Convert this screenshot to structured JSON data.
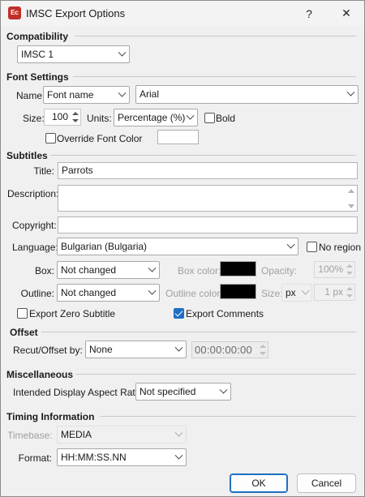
{
  "window": {
    "title": "IMSC Export Options",
    "app_icon_text": "Ec",
    "help_glyph": "?",
    "close_glyph": "✕"
  },
  "compatibility": {
    "section": "Compatibility",
    "value": "IMSC 1"
  },
  "font": {
    "section": "Font Settings",
    "name_label": "Name:",
    "name_type": "Font name",
    "font_value": "Arial",
    "size_label": "Size:",
    "size_value": "100",
    "units_label": "Units:",
    "units_value": "Percentage (%)",
    "bold_label": "Bold",
    "bold_checked": false,
    "override_label": "Override Font Color",
    "override_checked": false,
    "override_color": "#ffffff"
  },
  "subtitles": {
    "section": "Subtitles",
    "title_label": "Title:",
    "title_value": "Parrots",
    "description_label": "Description:",
    "description_value": "",
    "copyright_label": "Copyright:",
    "copyright_value": "",
    "language_label": "Language:",
    "language_value": "Bulgarian (Bulgaria)",
    "no_region_label": "No region",
    "no_region_checked": false,
    "box_label": "Box:",
    "box_value": "Not changed",
    "box_color_label": "Box color:",
    "box_color": "#000000",
    "opacity_label": "Opacity:",
    "opacity_value": "100%",
    "outline_label": "Outline:",
    "outline_value": "Not changed",
    "outline_color_label": "Outline color:",
    "outline_color": "#000000",
    "size_label": "Size:",
    "size_unit": "px",
    "size_value": "1 px",
    "export_zero_label": "Export Zero Subtitle",
    "export_zero_checked": false,
    "export_comments_label": "Export Comments",
    "export_comments_checked": true
  },
  "offset": {
    "section": "Offset",
    "recut_label": "Recut/Offset by:",
    "recut_value": "None",
    "time_value": "00:00:00:00"
  },
  "misc": {
    "section": "Miscellaneous",
    "aspect_label": "Intended Display Aspect Ratio:",
    "aspect_value": "Not specified"
  },
  "timing": {
    "section": "Timing Information",
    "timebase_label": "Timebase:",
    "timebase_value": "MEDIA",
    "format_label": "Format:",
    "format_value": "HH:MM:SS.NN"
  },
  "buttons": {
    "ok": "OK",
    "cancel": "Cancel"
  },
  "colors": {
    "accent": "#1e6fc3",
    "app_icon": "#c0302a"
  }
}
